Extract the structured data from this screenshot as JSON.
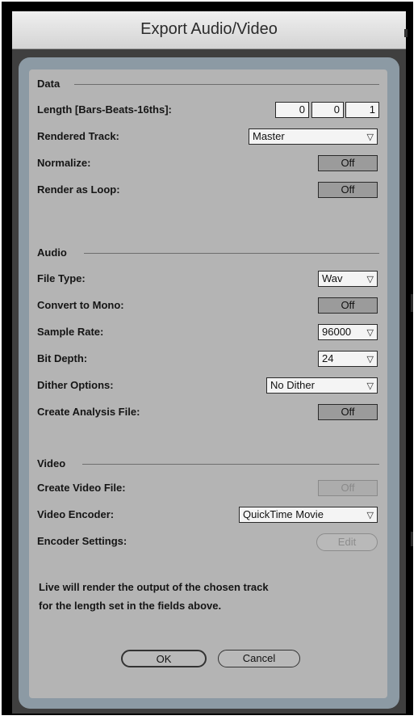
{
  "window": {
    "title": "Export Audio/Video"
  },
  "sections": {
    "data": "Data",
    "audio": "Audio",
    "video": "Video"
  },
  "length": {
    "label": "Length [Bars-Beats-16ths]:",
    "bars": "0",
    "beats": "0",
    "sixteenths": "1"
  },
  "rendered_track": {
    "label": "Rendered Track:",
    "value": "Master"
  },
  "normalize": {
    "label": "Normalize:",
    "value": "Off"
  },
  "render_as_loop": {
    "label": "Render as Loop:",
    "value": "Off"
  },
  "file_type": {
    "label": "File Type:",
    "value": "Wav"
  },
  "convert_to_mono": {
    "label": "Convert to Mono:",
    "value": "Off"
  },
  "sample_rate": {
    "label": "Sample Rate:",
    "value": "96000"
  },
  "bit_depth": {
    "label": "Bit Depth:",
    "value": "24"
  },
  "dither_options": {
    "label": "Dither Options:",
    "value": "No Dither"
  },
  "create_analysis_file": {
    "label": "Create Analysis File:",
    "value": "Off"
  },
  "create_video_file": {
    "label": "Create Video File:",
    "value": "Off"
  },
  "video_encoder": {
    "label": "Video Encoder:",
    "value": "QuickTime Movie"
  },
  "encoder_settings": {
    "label": "Encoder Settings:",
    "button": "Edit"
  },
  "info_text": {
    "line1": "Live will render the output of the chosen track",
    "line2": "for the length set in the fields above."
  },
  "buttons": {
    "ok": "OK",
    "cancel": "Cancel"
  },
  "icons": {
    "dropdown": "chevron-down-icon"
  },
  "colors": {
    "panel": "#b4b4b4",
    "outer": "#8c9aa4",
    "frame": "#000000"
  }
}
